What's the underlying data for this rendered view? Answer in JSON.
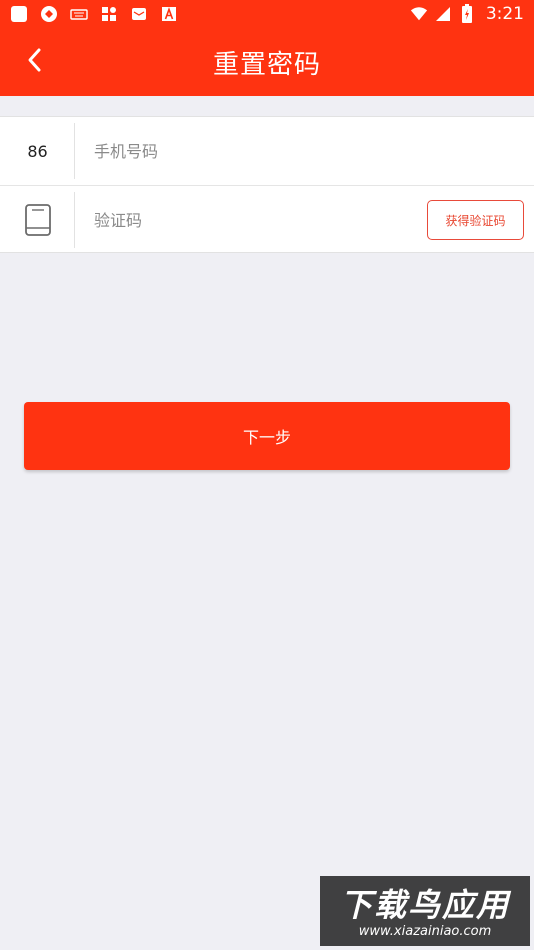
{
  "status_bar": {
    "time": "3:21",
    "left_icons": [
      "app-square-icon",
      "sync-icon",
      "keyboard-icon",
      "apps-grid-icon",
      "mail-icon",
      "font-a-icon"
    ],
    "right_icons": [
      "wifi-icon",
      "signal-icon",
      "battery-icon"
    ]
  },
  "header": {
    "title": "重置密码",
    "back_icon": "chevron-left-icon",
    "background": "#ff3311"
  },
  "form": {
    "phone": {
      "country_code": "86",
      "placeholder": "手机号码",
      "value": ""
    },
    "verification": {
      "icon": "phone-icon",
      "placeholder": "验证码",
      "value": "",
      "get_code_label": "获得验证码"
    }
  },
  "actions": {
    "next_label": "下一步"
  },
  "watermark": {
    "title": "下载鸟应用",
    "url": "www.xiazainiao.com"
  },
  "colors": {
    "accent": "#ff3311",
    "background": "#efeff4",
    "code_button_border": "#e84a3a"
  }
}
